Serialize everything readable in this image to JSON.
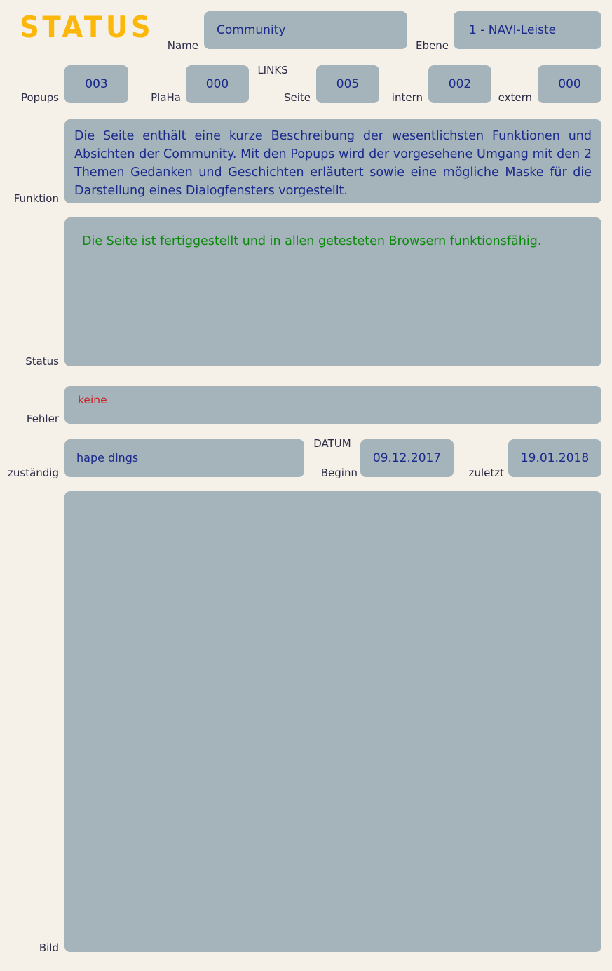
{
  "title": "STATUS",
  "accent_color": "#fbb80a",
  "panel_color": "#a5b3ba",
  "background_color": "#f5f1e9",
  "value_color": "#1a2a8c",
  "label_color": "#2b2b45",
  "header": {
    "name_label": "Name",
    "name_value": "Community",
    "ebene_label": "Ebene",
    "ebene_value": "1 - NAVI-Leiste"
  },
  "counters": {
    "popups_label": "Popups",
    "popups_value": "003",
    "plaha_label": "PlaHa",
    "plaha_value": "000",
    "links_group_label": "LINKS",
    "seite_label": "Seite",
    "seite_value": "005",
    "intern_label": "intern",
    "intern_value": "002",
    "extern_label": "extern",
    "extern_value": "000"
  },
  "funktion": {
    "label": "Funktion",
    "text": "Die Seite enthält eine kurze Beschreibung der wesentlichsten Funktionen und Absichten der Community. Mit den Popups wird der vorgesehene Umgang mit den 2 Themen Gedanken und Geschichten erläutert sowie eine mögliche Maske für die Darstellung eines Dialogfensters vorgestellt."
  },
  "status": {
    "label": "Status",
    "text": "Die Seite ist fertiggestellt und in allen getesteten Browsern funktionsfähig.",
    "color": "#0a8a0a"
  },
  "fehler": {
    "label": "Fehler",
    "text": "keine",
    "color": "#cc2222"
  },
  "footer": {
    "zustaendig_label": "zuständig",
    "zustaendig_value": "hape dings",
    "datum_group_label": "DATUM",
    "beginn_label": "Beginn",
    "beginn_value": "09.12.2017",
    "zuletzt_label": "zuletzt",
    "zuletzt_value": "19.01.2018"
  },
  "bild": {
    "label": "Bild"
  }
}
